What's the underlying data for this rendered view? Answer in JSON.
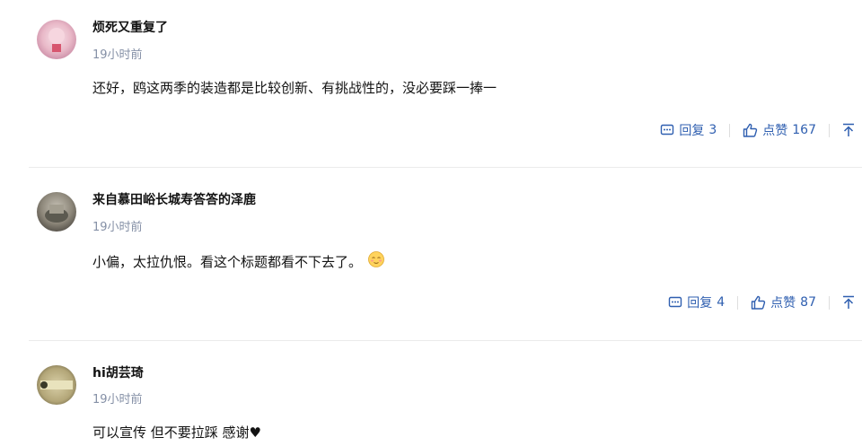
{
  "comments": [
    {
      "username": "烦死又重复了",
      "time": "19小时前",
      "content": "还好，鸥这两季的装造都是比较创新、有挑战性的，没必要踩一捧一",
      "reply_label": "回复",
      "reply_count": "3",
      "like_label": "点赞",
      "like_count": "167"
    },
    {
      "username": "来自慕田峪长城寿答答的泽鹿",
      "time": "19小时前",
      "content": "小偏，太拉仇恨。看这个标题都看不下去了。",
      "emoji": "blushing-face-emoji",
      "reply_label": "回复",
      "reply_count": "4",
      "like_label": "点赞",
      "like_count": "87"
    },
    {
      "username": "hi胡芸琦",
      "time": "19小时前",
      "content": "可以宣传 但不要拉踩 感谢♥"
    }
  ],
  "colors": {
    "action_blue": "#2f5fb0",
    "time_gray": "#8590a6",
    "divider": "#ebebeb"
  }
}
